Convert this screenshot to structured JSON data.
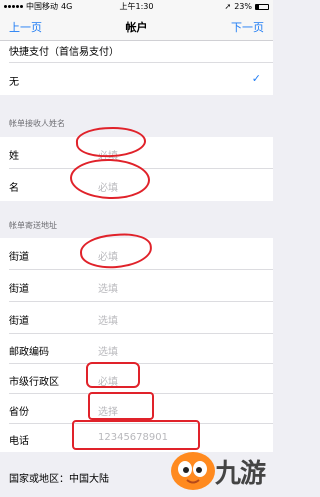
{
  "status_bar": {
    "carrier": "中国移动",
    "network": "4G",
    "time": "上午1:30",
    "battery_percent": "23%",
    "battery_level": 0.23
  },
  "nav": {
    "back_label": "上一页",
    "title": "帐户",
    "next_label": "下一页"
  },
  "payment": {
    "row_label": "快捷支付（首信易支付）",
    "selected_label": "无"
  },
  "name_section": {
    "header": "帐单接收人姓名",
    "fields": [
      {
        "label": "姓",
        "placeholder": "必填"
      },
      {
        "label": "名",
        "placeholder": "必填"
      }
    ]
  },
  "address_section": {
    "header": "帐单寄送地址",
    "fields": [
      {
        "label": "街道",
        "placeholder": "必填"
      },
      {
        "label": "街道",
        "placeholder": "选填"
      },
      {
        "label": "街道",
        "placeholder": "选填"
      },
      {
        "label": "邮政编码",
        "placeholder": "选填"
      },
      {
        "label": "市级行政区",
        "placeholder": "必填"
      },
      {
        "label": "省份",
        "placeholder": "选择"
      },
      {
        "label": "电话",
        "placeholder": "12345678901"
      }
    ],
    "country_label": "国家或地区：",
    "country_value": "中国大陆"
  },
  "watermark": {
    "text": "九游"
  },
  "colors": {
    "accent": "#1f7cf4",
    "annotation_red": "#e0222a",
    "background": "#efeff4"
  }
}
